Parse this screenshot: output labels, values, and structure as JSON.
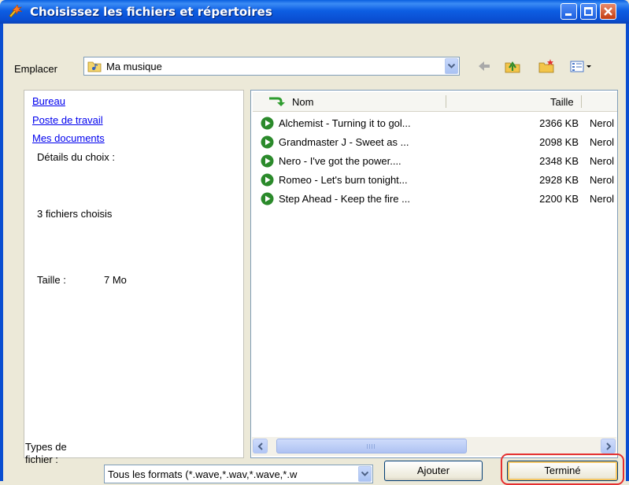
{
  "window": {
    "title": "Choisissez les fichiers et répertoires"
  },
  "location": {
    "label": "Emplacer",
    "value": "Ma musique"
  },
  "toolbar": {
    "icons": [
      "back-icon",
      "up-folder-icon",
      "new-folder-icon",
      "view-menu-icon"
    ]
  },
  "left_panel": {
    "links": [
      "Bureau",
      "Poste de travail",
      "Mes documents"
    ],
    "details_title": "Détails du choix :",
    "count_text": "3 fichiers choisis",
    "size_label": "Taille :",
    "size_value": "7 Mo"
  },
  "file_list": {
    "columns": {
      "name": "Nom",
      "size": "Taille"
    },
    "rows": [
      {
        "name": "Alchemist - Turning it to gol...",
        "size": "2366 KB",
        "type": "Nerol"
      },
      {
        "name": "Grandmaster J - Sweet as ...",
        "size": "2098 KB",
        "type": "Nerol"
      },
      {
        "name": "Nero -  I've got the power....",
        "size": "2348 KB",
        "type": "Nerol"
      },
      {
        "name": "Romeo -  Let's burn tonight...",
        "size": "2928 KB",
        "type": "Nerol"
      },
      {
        "name": "Step Ahead - Keep the fire ...",
        "size": "2200 KB",
        "type": "Nerol"
      }
    ]
  },
  "file_types": {
    "label_line1": "Types de",
    "label_line2": "fichier :",
    "value": "Tous les formats  (*.wave,*.wav,*.wave,*.w"
  },
  "buttons": {
    "add": "Ajouter",
    "done": "Terminé"
  },
  "colors": {
    "highlight": "#e53030",
    "titlebar": "#0a5fe0",
    "link": "#0000ee"
  }
}
